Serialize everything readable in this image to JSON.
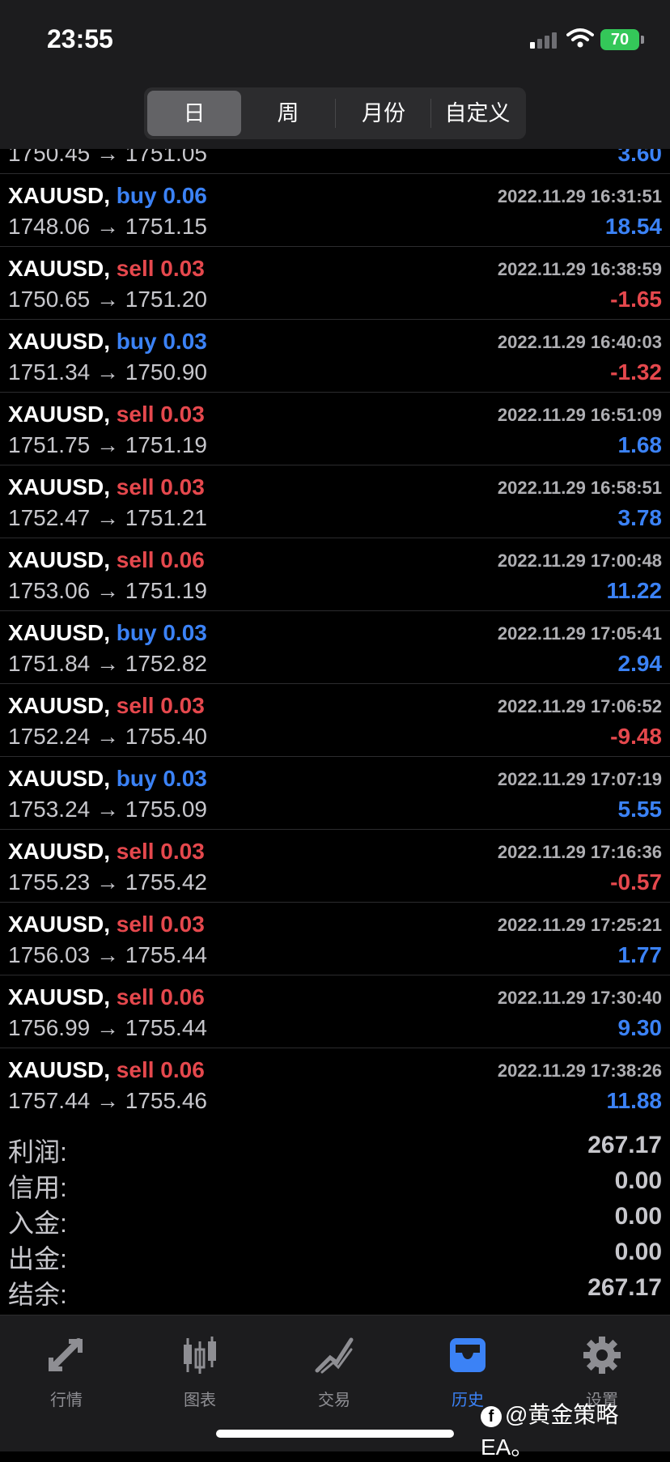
{
  "status_bar": {
    "time": "23:55",
    "battery": "70"
  },
  "period_tabs": [
    {
      "label": "日",
      "active": true
    },
    {
      "label": "周",
      "active": false
    },
    {
      "label": "月份",
      "active": false
    },
    {
      "label": "自定义",
      "active": false
    }
  ],
  "partial_row": {
    "price": "1750.45 → 1751.05",
    "pnl": "3.60"
  },
  "trades": [
    {
      "symbol": "XAUUSD,",
      "side": "buy 0.06",
      "datetime": "2022.11.29 16:31:51",
      "price": "1748.06 → 1751.15",
      "pnl": "18.54",
      "positive": true
    },
    {
      "symbol": "XAUUSD,",
      "side": "sell 0.03",
      "datetime": "2022.11.29 16:38:59",
      "price": "1750.65 → 1751.20",
      "pnl": "-1.65",
      "positive": false
    },
    {
      "symbol": "XAUUSD,",
      "side": "buy 0.03",
      "datetime": "2022.11.29 16:40:03",
      "price": "1751.34 → 1750.90",
      "pnl": "-1.32",
      "positive": false
    },
    {
      "symbol": "XAUUSD,",
      "side": "sell 0.03",
      "datetime": "2022.11.29 16:51:09",
      "price": "1751.75 → 1751.19",
      "pnl": "1.68",
      "positive": true
    },
    {
      "symbol": "XAUUSD,",
      "side": "sell 0.03",
      "datetime": "2022.11.29 16:58:51",
      "price": "1752.47 → 1751.21",
      "pnl": "3.78",
      "positive": true
    },
    {
      "symbol": "XAUUSD,",
      "side": "sell 0.06",
      "datetime": "2022.11.29 17:00:48",
      "price": "1753.06 → 1751.19",
      "pnl": "11.22",
      "positive": true
    },
    {
      "symbol": "XAUUSD,",
      "side": "buy 0.03",
      "datetime": "2022.11.29 17:05:41",
      "price": "1751.84 → 1752.82",
      "pnl": "2.94",
      "positive": true
    },
    {
      "symbol": "XAUUSD,",
      "side": "sell 0.03",
      "datetime": "2022.11.29 17:06:52",
      "price": "1752.24 → 1755.40",
      "pnl": "-9.48",
      "positive": false
    },
    {
      "symbol": "XAUUSD,",
      "side": "buy 0.03",
      "datetime": "2022.11.29 17:07:19",
      "price": "1753.24 → 1755.09",
      "pnl": "5.55",
      "positive": true
    },
    {
      "symbol": "XAUUSD,",
      "side": "sell 0.03",
      "datetime": "2022.11.29 17:16:36",
      "price": "1755.23 → 1755.42",
      "pnl": "-0.57",
      "positive": false
    },
    {
      "symbol": "XAUUSD,",
      "side": "sell 0.03",
      "datetime": "2022.11.29 17:25:21",
      "price": "1756.03 → 1755.44",
      "pnl": "1.77",
      "positive": true
    },
    {
      "symbol": "XAUUSD,",
      "side": "sell 0.06",
      "datetime": "2022.11.29 17:30:40",
      "price": "1756.99 → 1755.44",
      "pnl": "9.30",
      "positive": true
    },
    {
      "symbol": "XAUUSD,",
      "side": "sell 0.06",
      "datetime": "2022.11.29 17:38:26",
      "price": "1757.44 → 1755.46",
      "pnl": "11.88",
      "positive": true
    }
  ],
  "summary": [
    {
      "label": "利润:",
      "value": "267.17"
    },
    {
      "label": "信用:",
      "value": "0.00"
    },
    {
      "label": "入金:",
      "value": "0.00"
    },
    {
      "label": "出金:",
      "value": "0.00"
    },
    {
      "label": "结余:",
      "value": "267.17"
    }
  ],
  "tab_bar": [
    {
      "label": "行情",
      "icon": "quotes-icon",
      "active": false
    },
    {
      "label": "图表",
      "icon": "chart-icon",
      "active": false
    },
    {
      "label": "交易",
      "icon": "trade-icon",
      "active": false
    },
    {
      "label": "历史",
      "icon": "history-icon",
      "active": true
    },
    {
      "label": "设置",
      "icon": "settings-icon",
      "active": false
    }
  ],
  "watermark": {
    "fb": "f",
    "text": "@黄金策略EA。"
  },
  "colors": {
    "buy": "#3b82f6",
    "sell": "#e5484d",
    "active_tab": "#3b82f6"
  }
}
